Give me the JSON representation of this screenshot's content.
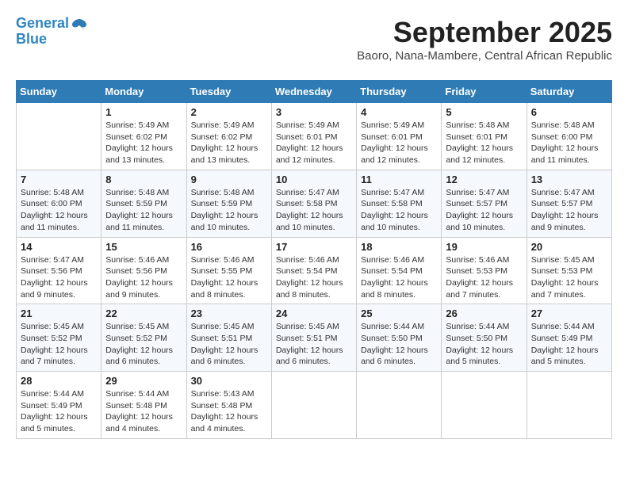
{
  "logo": {
    "line1": "General",
    "line2": "Blue"
  },
  "title": "September 2025",
  "subtitle": "Baoro, Nana-Mambere, Central African Republic",
  "days_of_week": [
    "Sunday",
    "Monday",
    "Tuesday",
    "Wednesday",
    "Thursday",
    "Friday",
    "Saturday"
  ],
  "weeks": [
    [
      {
        "day": "",
        "info": ""
      },
      {
        "day": "1",
        "info": "Sunrise: 5:49 AM\nSunset: 6:02 PM\nDaylight: 12 hours\nand 13 minutes."
      },
      {
        "day": "2",
        "info": "Sunrise: 5:49 AM\nSunset: 6:02 PM\nDaylight: 12 hours\nand 13 minutes."
      },
      {
        "day": "3",
        "info": "Sunrise: 5:49 AM\nSunset: 6:01 PM\nDaylight: 12 hours\nand 12 minutes."
      },
      {
        "day": "4",
        "info": "Sunrise: 5:49 AM\nSunset: 6:01 PM\nDaylight: 12 hours\nand 12 minutes."
      },
      {
        "day": "5",
        "info": "Sunrise: 5:48 AM\nSunset: 6:01 PM\nDaylight: 12 hours\nand 12 minutes."
      },
      {
        "day": "6",
        "info": "Sunrise: 5:48 AM\nSunset: 6:00 PM\nDaylight: 12 hours\nand 11 minutes."
      }
    ],
    [
      {
        "day": "7",
        "info": "Sunrise: 5:48 AM\nSunset: 6:00 PM\nDaylight: 12 hours\nand 11 minutes."
      },
      {
        "day": "8",
        "info": "Sunrise: 5:48 AM\nSunset: 5:59 PM\nDaylight: 12 hours\nand 11 minutes."
      },
      {
        "day": "9",
        "info": "Sunrise: 5:48 AM\nSunset: 5:59 PM\nDaylight: 12 hours\nand 10 minutes."
      },
      {
        "day": "10",
        "info": "Sunrise: 5:47 AM\nSunset: 5:58 PM\nDaylight: 12 hours\nand 10 minutes."
      },
      {
        "day": "11",
        "info": "Sunrise: 5:47 AM\nSunset: 5:58 PM\nDaylight: 12 hours\nand 10 minutes."
      },
      {
        "day": "12",
        "info": "Sunrise: 5:47 AM\nSunset: 5:57 PM\nDaylight: 12 hours\nand 10 minutes."
      },
      {
        "day": "13",
        "info": "Sunrise: 5:47 AM\nSunset: 5:57 PM\nDaylight: 12 hours\nand 9 minutes."
      }
    ],
    [
      {
        "day": "14",
        "info": "Sunrise: 5:47 AM\nSunset: 5:56 PM\nDaylight: 12 hours\nand 9 minutes."
      },
      {
        "day": "15",
        "info": "Sunrise: 5:46 AM\nSunset: 5:56 PM\nDaylight: 12 hours\nand 9 minutes."
      },
      {
        "day": "16",
        "info": "Sunrise: 5:46 AM\nSunset: 5:55 PM\nDaylight: 12 hours\nand 8 minutes."
      },
      {
        "day": "17",
        "info": "Sunrise: 5:46 AM\nSunset: 5:54 PM\nDaylight: 12 hours\nand 8 minutes."
      },
      {
        "day": "18",
        "info": "Sunrise: 5:46 AM\nSunset: 5:54 PM\nDaylight: 12 hours\nand 8 minutes."
      },
      {
        "day": "19",
        "info": "Sunrise: 5:46 AM\nSunset: 5:53 PM\nDaylight: 12 hours\nand 7 minutes."
      },
      {
        "day": "20",
        "info": "Sunrise: 5:45 AM\nSunset: 5:53 PM\nDaylight: 12 hours\nand 7 minutes."
      }
    ],
    [
      {
        "day": "21",
        "info": "Sunrise: 5:45 AM\nSunset: 5:52 PM\nDaylight: 12 hours\nand 7 minutes."
      },
      {
        "day": "22",
        "info": "Sunrise: 5:45 AM\nSunset: 5:52 PM\nDaylight: 12 hours\nand 6 minutes."
      },
      {
        "day": "23",
        "info": "Sunrise: 5:45 AM\nSunset: 5:51 PM\nDaylight: 12 hours\nand 6 minutes."
      },
      {
        "day": "24",
        "info": "Sunrise: 5:45 AM\nSunset: 5:51 PM\nDaylight: 12 hours\nand 6 minutes."
      },
      {
        "day": "25",
        "info": "Sunrise: 5:44 AM\nSunset: 5:50 PM\nDaylight: 12 hours\nand 6 minutes."
      },
      {
        "day": "26",
        "info": "Sunrise: 5:44 AM\nSunset: 5:50 PM\nDaylight: 12 hours\nand 5 minutes."
      },
      {
        "day": "27",
        "info": "Sunrise: 5:44 AM\nSunset: 5:49 PM\nDaylight: 12 hours\nand 5 minutes."
      }
    ],
    [
      {
        "day": "28",
        "info": "Sunrise: 5:44 AM\nSunset: 5:49 PM\nDaylight: 12 hours\nand 5 minutes."
      },
      {
        "day": "29",
        "info": "Sunrise: 5:44 AM\nSunset: 5:48 PM\nDaylight: 12 hours\nand 4 minutes."
      },
      {
        "day": "30",
        "info": "Sunrise: 5:43 AM\nSunset: 5:48 PM\nDaylight: 12 hours\nand 4 minutes."
      },
      {
        "day": "",
        "info": ""
      },
      {
        "day": "",
        "info": ""
      },
      {
        "day": "",
        "info": ""
      },
      {
        "day": "",
        "info": ""
      }
    ]
  ]
}
